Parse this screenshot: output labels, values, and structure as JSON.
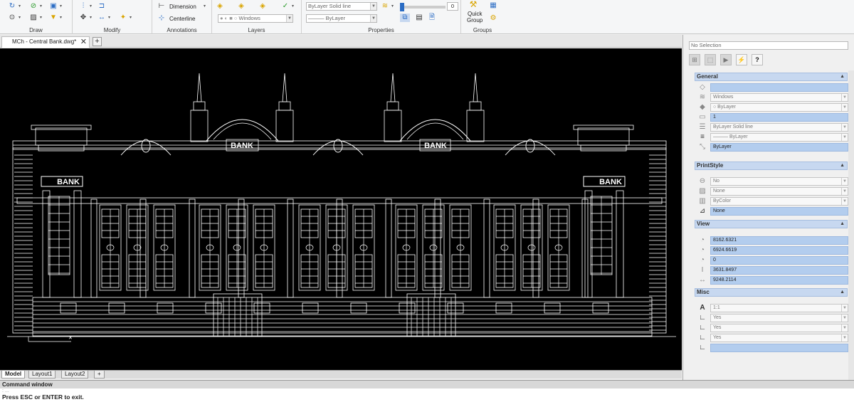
{
  "ribbon": {
    "groups": {
      "draw": "Draw",
      "modify": "Modify",
      "annotations": "Annotations",
      "layers": "Layers",
      "properties": "Properties",
      "groups": "Groups"
    },
    "dimension_label": "Dimension",
    "centerline_label": "Centerline",
    "layer_combo": "Windows",
    "prop_linetype_combo": "ByLayer    Solid line",
    "prop_lineweight_combo": "——— ByLayer",
    "transparency_value": "0",
    "quick_group_label_1": "Quick",
    "quick_group_label_2": "Group"
  },
  "document_tab": {
    "title": "MCh - Central Bank.dwg*",
    "close": "✕",
    "add": "+"
  },
  "drawing": {
    "sign_left": "BANK",
    "sign_mid_left": "BANK",
    "sign_mid_right": "BANK",
    "sign_right": "BANK"
  },
  "layout_tabs": [
    "Model",
    "Layout1",
    "Layout2",
    "+"
  ],
  "command": {
    "header": "Command window",
    "line_previous": ": ...",
    "prompt": "Press ESC or ENTER to exit."
  },
  "properties_panel": {
    "selection": "No Selection",
    "sections": {
      "general": "General",
      "printstyle": "PrintStyle",
      "view": "View",
      "misc": "Misc"
    },
    "general_rows": [
      "",
      "Windows",
      "○ ByLayer",
      "1",
      "ByLayer    Solid line",
      "——— ByLayer",
      "ByLayer"
    ],
    "printstyle_rows": [
      "No",
      "None",
      "ByColor",
      "None"
    ],
    "view_rows": [
      "8162.6321",
      "6924.6619",
      "0",
      "3631.8497",
      "9248.2114"
    ],
    "misc_rows": [
      "1:1",
      "Yes",
      "Yes",
      "Yes",
      ""
    ]
  },
  "colors": {
    "canvas": "#000000",
    "drawing_lines": "#ffffff",
    "highlight": "#b3cdee",
    "section_header": "#c7d8f0"
  }
}
